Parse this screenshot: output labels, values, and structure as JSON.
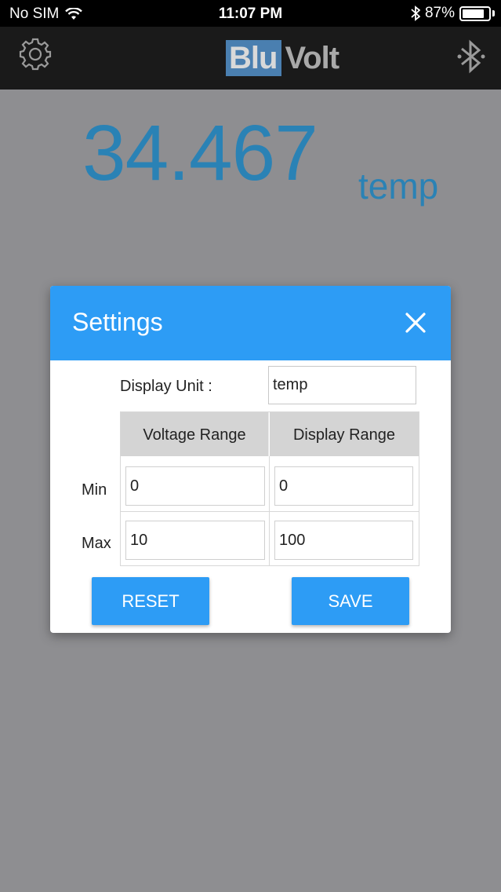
{
  "status_bar": {
    "carrier": "No SIM",
    "time": "11:07 PM",
    "battery_percent": "87%",
    "battery_level": 0.87
  },
  "header": {
    "logo_part1": "Blu",
    "logo_part2": "Volt",
    "settings_icon": "gear-icon",
    "bluetooth_icon": "bluetooth-icon"
  },
  "reading": {
    "value": "34.467",
    "unit": "temp"
  },
  "settings_dialog": {
    "title": "Settings",
    "display_unit_label": "Display Unit :",
    "display_unit_value": "temp",
    "column_headers": [
      "Voltage Range",
      "Display Range"
    ],
    "rows": [
      {
        "label": "Min",
        "voltage": "0",
        "display": "0"
      },
      {
        "label": "Max",
        "voltage": "10",
        "display": "100"
      }
    ],
    "reset_label": "RESET",
    "save_label": "SAVE"
  },
  "colors": {
    "accent_blue": "#2d9cf5",
    "reading_blue": "#2a82b5",
    "overlay_gray": "#8e8e91",
    "header_dark": "#1a1a1a"
  }
}
